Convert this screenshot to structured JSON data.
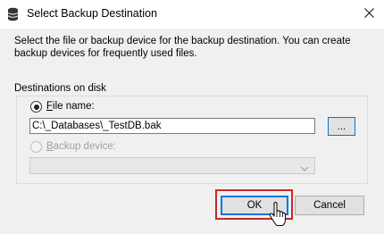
{
  "window": {
    "title": "Select Backup Destination",
    "icon": "database-icon",
    "close_icon": "close-icon"
  },
  "description": "Select the file or backup device for the backup destination. You can create backup devices for frequently used files.",
  "destinations": {
    "section_label": "Destinations on disk",
    "file_name": {
      "label_accesskey": "F",
      "label_rest": "ile name:",
      "selected": true,
      "value": "C:\\_Databases\\_TestDB.bak",
      "browse_label": "..."
    },
    "backup_device": {
      "label_accesskey": "B",
      "label_rest": "ackup device:",
      "selected": false,
      "enabled": false,
      "value": ""
    }
  },
  "buttons": {
    "ok_label": "OK",
    "cancel_label": "Cancel"
  },
  "colors": {
    "accent": "#0078d7",
    "highlight": "#c8282a"
  }
}
